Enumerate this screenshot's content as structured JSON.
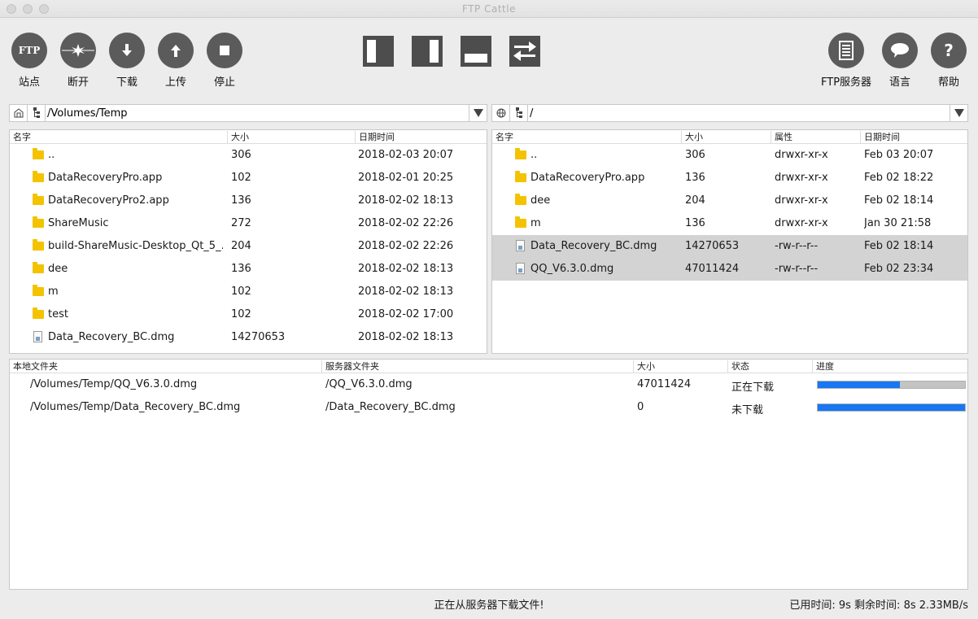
{
  "window": {
    "title": "FTP Cattle"
  },
  "toolbar": {
    "site": {
      "label": "站点",
      "icon_text": "FTP"
    },
    "disconnect": {
      "label": "断开"
    },
    "download": {
      "label": "下载"
    },
    "upload": {
      "label": "上传"
    },
    "stop": {
      "label": "停止"
    },
    "ftp_server": {
      "label": "FTP服务器"
    },
    "language": {
      "label": "语言"
    },
    "help": {
      "label": "帮助",
      "icon_text": "?"
    }
  },
  "local": {
    "path": "/Volumes/Temp",
    "columns": {
      "name": "名字",
      "size": "大小",
      "date": "日期时间"
    },
    "rows": [
      {
        "type": "folder",
        "name": "..",
        "size": "306",
        "date": "2018-02-03 20:07"
      },
      {
        "type": "folder",
        "name": "DataRecoveryPro.app",
        "size": "102",
        "date": "2018-02-01 20:25"
      },
      {
        "type": "folder",
        "name": "DataRecoveryPro2.app",
        "size": "136",
        "date": "2018-02-02 18:13"
      },
      {
        "type": "folder",
        "name": "ShareMusic",
        "size": "272",
        "date": "2018-02-02 22:26"
      },
      {
        "type": "folder",
        "name": "build-ShareMusic-Desktop_Qt_5_...",
        "size": "204",
        "date": "2018-02-02 22:26"
      },
      {
        "type": "folder",
        "name": "dee",
        "size": "136",
        "date": "2018-02-02 18:13"
      },
      {
        "type": "folder",
        "name": "m",
        "size": "102",
        "date": "2018-02-02 18:13"
      },
      {
        "type": "folder",
        "name": "test",
        "size": "102",
        "date": "2018-02-02 17:00"
      },
      {
        "type": "file",
        "name": "Data_Recovery_BC.dmg",
        "size": "14270653",
        "date": "2018-02-02 18:13"
      }
    ]
  },
  "remote": {
    "path": "/",
    "columns": {
      "name": "名字",
      "size": "大小",
      "attr": "属性",
      "date": "日期时间"
    },
    "rows": [
      {
        "type": "folder",
        "name": "..",
        "size": "306",
        "attr": "drwxr-xr-x",
        "date": "Feb 03 20:07",
        "selected": false
      },
      {
        "type": "folder",
        "name": "DataRecoveryPro.app",
        "size": "136",
        "attr": "drwxr-xr-x",
        "date": "Feb 02 18:22",
        "selected": false
      },
      {
        "type": "folder",
        "name": "dee",
        "size": "204",
        "attr": "drwxr-xr-x",
        "date": "Feb 02 18:14",
        "selected": false
      },
      {
        "type": "folder",
        "name": "m",
        "size": "136",
        "attr": "drwxr-xr-x",
        "date": "Jan 30 21:58",
        "selected": false
      },
      {
        "type": "file",
        "name": "Data_Recovery_BC.dmg",
        "size": "14270653",
        "attr": "-rw-r--r--",
        "date": "Feb 02 18:14",
        "selected": true
      },
      {
        "type": "file",
        "name": "QQ_V6.3.0.dmg",
        "size": "47011424",
        "attr": "-rw-r--r--",
        "date": "Feb 02 23:34",
        "selected": true
      }
    ]
  },
  "transfers": {
    "columns": {
      "local": "本地文件夹",
      "server": "服务器文件夹",
      "size": "大小",
      "status": "状态",
      "progress": "进度"
    },
    "rows": [
      {
        "local": "/Volumes/Temp/QQ_V6.3.0.dmg",
        "server": "/QQ_V6.3.0.dmg",
        "size": "47011424",
        "status": "正在下载",
        "progress": 0.56
      },
      {
        "local": "/Volumes/Temp/Data_Recovery_BC.dmg",
        "server": "/Data_Recovery_BC.dmg",
        "size": "0",
        "status": "未下载",
        "progress": 1.0
      }
    ]
  },
  "status": {
    "message": "正在从服务器下载文件!",
    "elapsed_label": "已用时间:",
    "elapsed": "9s",
    "remaining_label": "剩余时间:",
    "remaining": "8s",
    "speed": "2.33MB/s"
  },
  "colors": {
    "progress_fill": "#1877f2",
    "progress_track": "#c3c3c3",
    "toolbar_button": "#5b5b5b",
    "folder": "#f3c300"
  }
}
